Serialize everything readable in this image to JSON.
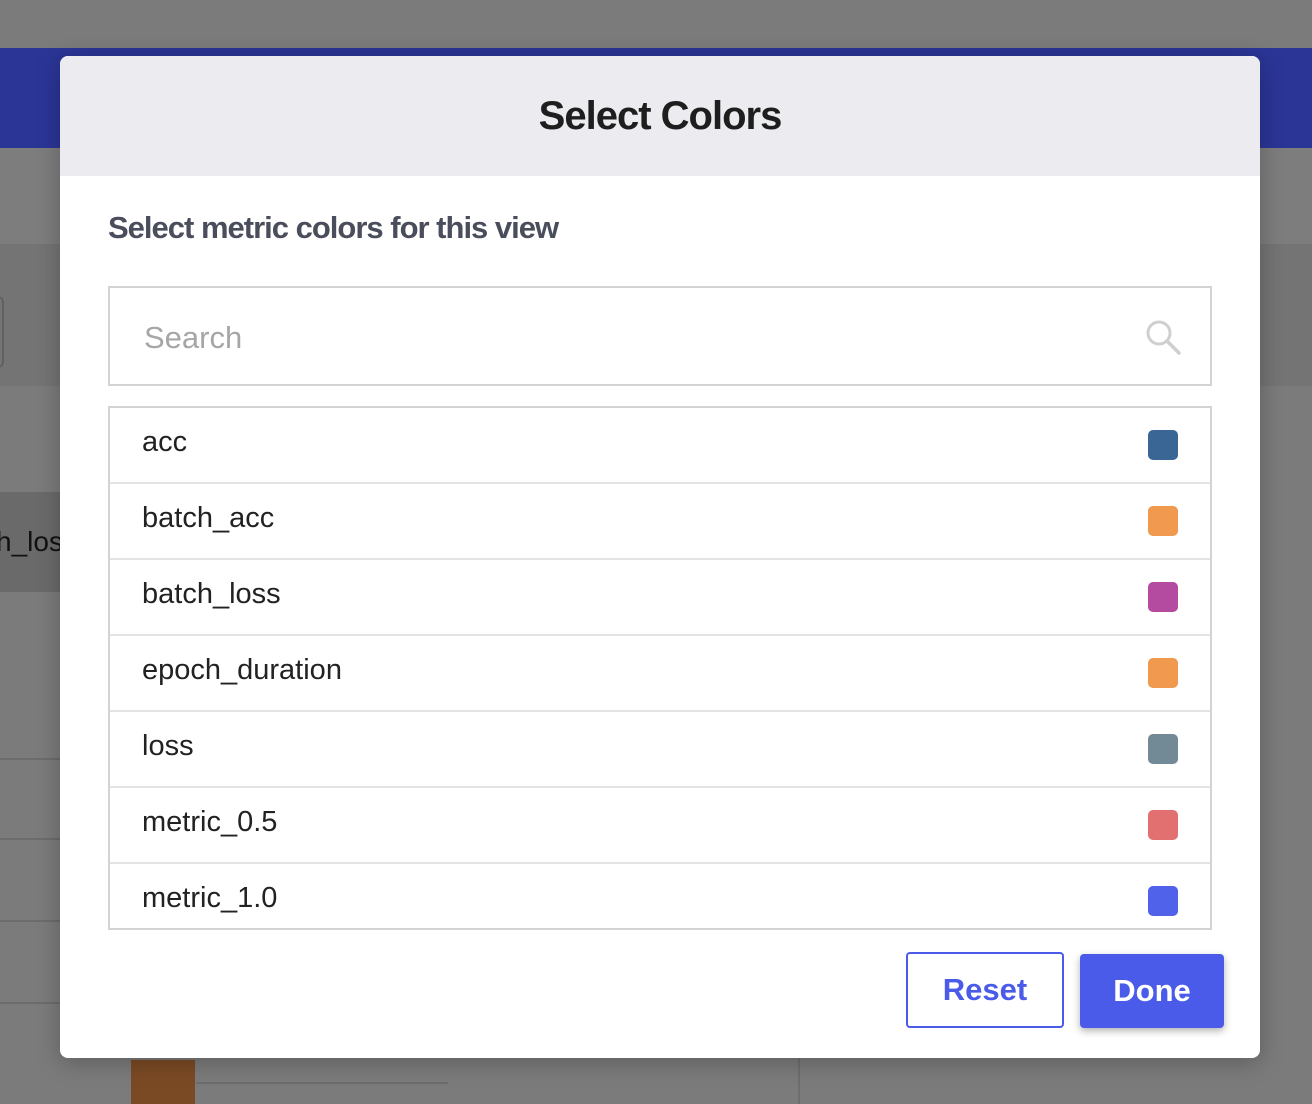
{
  "background": {
    "legend_text": "h_los"
  },
  "modal": {
    "title": "Select Colors",
    "subtitle": "Select metric colors for this view",
    "search": {
      "placeholder": "Search",
      "value": ""
    },
    "metrics": [
      {
        "label": "acc",
        "color": "#3a6696"
      },
      {
        "label": "batch_acc",
        "color": "#f0994f"
      },
      {
        "label": "batch_loss",
        "color": "#b54aa1"
      },
      {
        "label": "epoch_duration",
        "color": "#f0994f"
      },
      {
        "label": "loss",
        "color": "#718a96"
      },
      {
        "label": "metric_0.5",
        "color": "#e37070"
      },
      {
        "label": "metric_1.0",
        "color": "#4f62e9"
      }
    ],
    "buttons": {
      "reset_label": "Reset",
      "done_label": "Done"
    }
  },
  "icons": {
    "search": "search-icon"
  }
}
